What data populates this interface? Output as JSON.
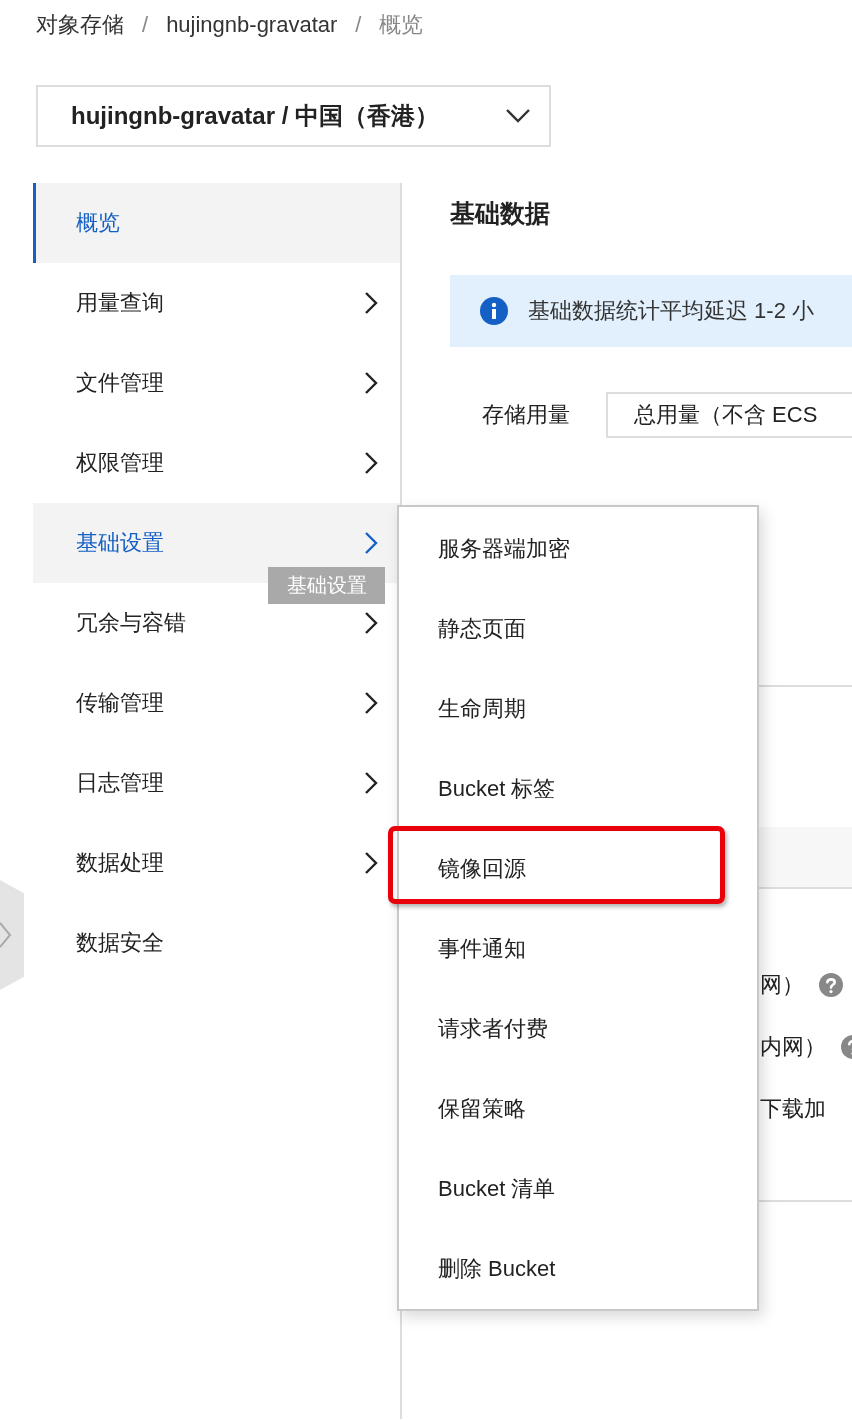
{
  "breadcrumb": [
    {
      "text": "对象存储",
      "kind": "link"
    },
    {
      "text": "/",
      "kind": "separator"
    },
    {
      "text": "hujingnb-gravatar",
      "kind": "link"
    },
    {
      "text": "/",
      "kind": "separator"
    },
    {
      "text": "概览",
      "kind": "current"
    }
  ],
  "bucket_select": {
    "value": "hujingnb-gravatar / 中国（香港）"
  },
  "sidebar": {
    "items": [
      {
        "label": "概览",
        "selected": true,
        "hovered": false,
        "has_submenu": false
      },
      {
        "label": "用量查询",
        "selected": false,
        "hovered": false,
        "has_submenu": true
      },
      {
        "label": "文件管理",
        "selected": false,
        "hovered": false,
        "has_submenu": true
      },
      {
        "label": "权限管理",
        "selected": false,
        "hovered": false,
        "has_submenu": true
      },
      {
        "label": "基础设置",
        "selected": false,
        "hovered": true,
        "has_submenu": true
      },
      {
        "label": "冗余与容错",
        "selected": false,
        "hovered": false,
        "has_submenu": true
      },
      {
        "label": "传输管理",
        "selected": false,
        "hovered": false,
        "has_submenu": true
      },
      {
        "label": "日志管理",
        "selected": false,
        "hovered": false,
        "has_submenu": true
      },
      {
        "label": "数据处理",
        "selected": false,
        "hovered": false,
        "has_submenu": true
      },
      {
        "label": "数据安全",
        "selected": false,
        "hovered": false,
        "has_submenu": false
      }
    ]
  },
  "tooltip": "基础设置",
  "main": {
    "title": "基础数据",
    "notice": "基础数据统计平均延迟 1-2 小",
    "storage_label": "存储用量",
    "storage_select": "总用量（不含 ECS",
    "rows": [
      {
        "text": "网）",
        "help": true
      },
      {
        "text": "内网）",
        "help": true
      },
      {
        "text": "下载加"
      }
    ]
  },
  "submenu": {
    "items": [
      {
        "label": "服务器端加密",
        "highlighted": false
      },
      {
        "label": "静态页面",
        "highlighted": false
      },
      {
        "label": "生命周期",
        "highlighted": false
      },
      {
        "label": "Bucket 标签",
        "highlighted": false
      },
      {
        "label": "镜像回源",
        "highlighted": true
      },
      {
        "label": "事件通知",
        "highlighted": false
      },
      {
        "label": "请求者付费",
        "highlighted": false
      },
      {
        "label": "保留策略",
        "highlighted": false
      },
      {
        "label": "Bucket 清单",
        "highlighted": false
      },
      {
        "label": "删除 Bucket",
        "highlighted": false
      }
    ]
  }
}
